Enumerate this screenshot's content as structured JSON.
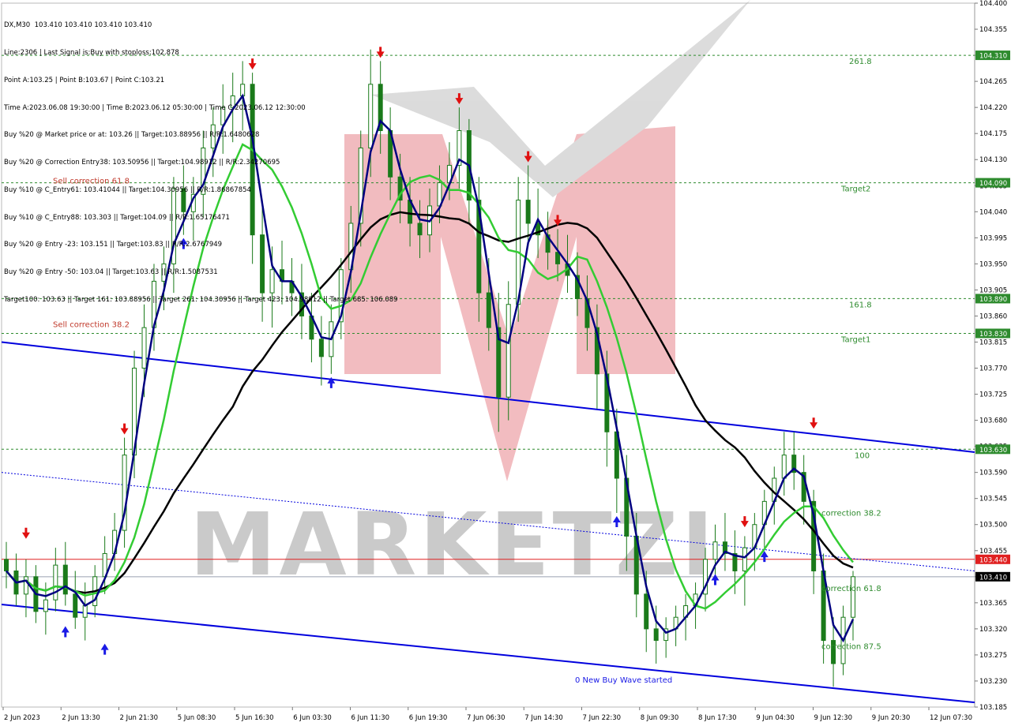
{
  "symbol_header": "DX,M30  103.410 103.410 103.410 103.410",
  "info_lines": [
    "Line:2306 | Last Signal is:Buy with stoploss:102.878",
    "Point A:103.25 | Point B:103.67 | Point C:103.21",
    "Time A:2023.06.08 19:30:00 | Time B:2023.06.12 05:30:00 | Time C:2023.06.12 12:30:00",
    "Buy %20 @ Market price or at: 103.26 || Target:103.88956 || R/R:1.6480628",
    "Buy %20 @ Correction Entry38: 103.50956 || Target:104.98912 || R/R:2.34270695",
    "Buy %10 @ C_Entry61: 103.41044 || Target:104.30956 || R/R:1.86867854",
    "Buy %10 @ C_Entry88: 103.303 || Target:104.09 || R/R:1.65176471",
    "Buy %20 @ Entry -23: 103.151 || Target:103.83 || R/R:2.6767949",
    "Buy %20 @ Entry -50: 103.04 || Target:103.63 || R/R:1.5087531",
    "Target100: 103.63 || Target 161: 103.88956 || Target 261: 104.30956 || Target 423: 104.98912 || Target 685: 106.089"
  ],
  "chart_data": {
    "type": "candlestick",
    "symbol": "DX",
    "timeframe": "M30",
    "ylim": [
      103.185,
      104.4
    ],
    "y_ticks": [
      "104.400",
      "104.355",
      "104.310",
      "104.265",
      "104.220",
      "104.175",
      "104.130",
      "104.085",
      "104.040",
      "103.995",
      "103.950",
      "103.905",
      "103.860",
      "103.815",
      "103.770",
      "103.725",
      "103.680",
      "103.635",
      "103.590",
      "103.545",
      "103.500",
      "103.455",
      "103.410",
      "103.365",
      "103.320",
      "103.275",
      "103.230",
      "103.185"
    ],
    "x_ticks": [
      "2 Jun 2023",
      "2 Jun 13:30",
      "2 Jun 21:30",
      "5 Jun 08:30",
      "5 Jun 16:30",
      "6 Jun 03:30",
      "6 Jun 11:30",
      "6 Jun 19:30",
      "7 Jun 06:30",
      "7 Jun 14:30",
      "7 Jun 22:30",
      "8 Jun 09:30",
      "8 Jun 17:30",
      "9 Jun 04:30",
      "9 Jun 12:30",
      "9 Jun 20:30",
      "12 Jun 07:30"
    ],
    "current_price": 103.41,
    "levels": [
      {
        "label": "261.8",
        "price": 104.31,
        "tag": "104.310",
        "color": "#2e8b2e"
      },
      {
        "label": "Target2",
        "price": 104.09,
        "tag": "104.090",
        "color": "#2e8b2e"
      },
      {
        "label": "161.8",
        "price": 103.89,
        "tag": "103.890",
        "color": "#2e8b2e"
      },
      {
        "label": "Target1",
        "price": 103.83,
        "tag": "103.830",
        "color": "#2e8b2e"
      },
      {
        "label": "100",
        "price": 103.63,
        "tag": "103.630",
        "color": "#2e8b2e"
      },
      {
        "label": "",
        "price": 103.44,
        "tag": "103.440",
        "color": "#e02020"
      }
    ],
    "annotations": [
      {
        "text": "Sell correction 61.8",
        "color": "#c0392b"
      },
      {
        "text": "Sell correction 38.2",
        "color": "#c0392b"
      },
      {
        "text": "correction 38.2",
        "color": "#2e8b2e"
      },
      {
        "text": "correction 61.8",
        "color": "#2e8b2e"
      },
      {
        "text": "correction 87.5",
        "color": "#2e8b2e"
      },
      {
        "text": "0 New Buy Wave started",
        "color": "#1a1ae6"
      }
    ],
    "colors": {
      "candle": "#1a7a1a",
      "ma_slow": "#000000",
      "ma_green": "#33cc33",
      "ma_navy": "#000080",
      "channel": "#0000dd",
      "level": "#2e8b2e",
      "stop": "#e02020"
    },
    "ohlc": [
      [
        103.44,
        103.47,
        103.39,
        103.42
      ],
      [
        103.42,
        103.45,
        103.36,
        103.38
      ],
      [
        103.38,
        103.44,
        103.34,
        103.41
      ],
      [
        103.41,
        103.43,
        103.33,
        103.35
      ],
      [
        103.35,
        103.4,
        103.31,
        103.37
      ],
      [
        103.37,
        103.46,
        103.35,
        103.43
      ],
      [
        103.43,
        103.47,
        103.36,
        103.38
      ],
      [
        103.38,
        103.42,
        103.32,
        103.34
      ],
      [
        103.34,
        103.4,
        103.3,
        103.36
      ],
      [
        103.36,
        103.43,
        103.34,
        103.41
      ],
      [
        103.41,
        103.48,
        103.38,
        103.45
      ],
      [
        103.45,
        103.52,
        103.42,
        103.49
      ],
      [
        103.49,
        103.65,
        103.46,
        103.62
      ],
      [
        103.62,
        103.8,
        103.58,
        103.77
      ],
      [
        103.77,
        103.88,
        103.72,
        103.84
      ],
      [
        103.84,
        103.95,
        103.8,
        103.92
      ],
      [
        103.92,
        103.98,
        103.87,
        103.95
      ],
      [
        103.95,
        104.1,
        103.9,
        104.08
      ],
      [
        104.08,
        104.12,
        104.0,
        104.04
      ],
      [
        104.04,
        104.1,
        103.99,
        104.07
      ],
      [
        104.07,
        104.18,
        104.03,
        104.15
      ],
      [
        104.15,
        104.22,
        104.1,
        104.19
      ],
      [
        104.19,
        104.26,
        104.14,
        104.22
      ],
      [
        104.22,
        104.28,
        104.16,
        104.24
      ],
      [
        104.24,
        104.3,
        104.18,
        104.26
      ],
      [
        104.26,
        104.28,
        103.95,
        104.0
      ],
      [
        104.0,
        104.06,
        103.85,
        103.9
      ],
      [
        103.9,
        103.98,
        103.84,
        103.94
      ],
      [
        103.94,
        103.99,
        103.88,
        103.92
      ],
      [
        103.92,
        103.96,
        103.86,
        103.9
      ],
      [
        103.9,
        103.95,
        103.82,
        103.86
      ],
      [
        103.86,
        103.9,
        103.78,
        103.82
      ],
      [
        103.82,
        103.86,
        103.74,
        103.79
      ],
      [
        103.79,
        103.88,
        103.76,
        103.85
      ],
      [
        103.85,
        103.96,
        103.82,
        103.94
      ],
      [
        103.94,
        104.05,
        103.9,
        104.02
      ],
      [
        104.02,
        104.18,
        103.98,
        104.15
      ],
      [
        104.15,
        104.32,
        104.1,
        104.26
      ],
      [
        104.26,
        104.3,
        104.14,
        104.18
      ],
      [
        104.18,
        104.22,
        104.06,
        104.1
      ],
      [
        104.1,
        104.14,
        104.02,
        104.06
      ],
      [
        104.06,
        104.1,
        103.98,
        104.02
      ],
      [
        104.02,
        104.06,
        103.96,
        104.0
      ],
      [
        104.0,
        104.08,
        103.97,
        104.05
      ],
      [
        104.05,
        104.12,
        104.02,
        104.09
      ],
      [
        104.09,
        104.16,
        104.06,
        104.12
      ],
      [
        104.12,
        104.22,
        104.08,
        104.18
      ],
      [
        104.18,
        104.2,
        104.02,
        104.06
      ],
      [
        104.06,
        104.1,
        103.85,
        103.9
      ],
      [
        103.9,
        103.96,
        103.8,
        103.84
      ],
      [
        103.84,
        103.9,
        103.66,
        103.72
      ],
      [
        103.72,
        103.92,
        103.68,
        103.88
      ],
      [
        103.88,
        104.1,
        103.85,
        104.06
      ],
      [
        104.06,
        104.12,
        103.98,
        104.02
      ],
      [
        104.02,
        104.08,
        103.96,
        104.0
      ],
      [
        104.0,
        104.04,
        103.94,
        103.97
      ],
      [
        103.97,
        104.01,
        103.92,
        103.95
      ],
      [
        103.95,
        104.0,
        103.9,
        103.93
      ],
      [
        103.93,
        103.97,
        103.86,
        103.89
      ],
      [
        103.89,
        103.93,
        103.8,
        103.84
      ],
      [
        103.84,
        103.88,
        103.7,
        103.76
      ],
      [
        103.76,
        103.8,
        103.6,
        103.66
      ],
      [
        103.66,
        103.7,
        103.52,
        103.58
      ],
      [
        103.58,
        103.62,
        103.42,
        103.48
      ],
      [
        103.48,
        103.52,
        103.34,
        103.38
      ],
      [
        103.38,
        103.42,
        103.28,
        103.32
      ],
      [
        103.32,
        103.36,
        103.26,
        103.3
      ],
      [
        103.3,
        103.34,
        103.27,
        103.32
      ],
      [
        103.32,
        103.36,
        103.29,
        103.34
      ],
      [
        103.34,
        103.38,
        103.3,
        103.36
      ],
      [
        103.36,
        103.4,
        103.32,
        103.38
      ],
      [
        103.38,
        103.46,
        103.35,
        103.44
      ],
      [
        103.44,
        103.5,
        103.4,
        103.47
      ],
      [
        103.47,
        103.52,
        103.42,
        103.45
      ],
      [
        103.45,
        103.49,
        103.38,
        103.42
      ],
      [
        103.42,
        103.48,
        103.36,
        103.46
      ],
      [
        103.46,
        103.52,
        103.42,
        103.5
      ],
      [
        103.5,
        103.56,
        103.46,
        103.54
      ],
      [
        103.54,
        103.6,
        103.5,
        103.58
      ],
      [
        103.58,
        103.66,
        103.55,
        103.62
      ],
      [
        103.62,
        103.66,
        103.56,
        103.59
      ],
      [
        103.59,
        103.62,
        103.5,
        103.54
      ],
      [
        103.54,
        103.56,
        103.38,
        103.42
      ],
      [
        103.42,
        103.45,
        103.26,
        103.3
      ],
      [
        103.3,
        103.34,
        103.22,
        103.26
      ],
      [
        103.26,
        103.36,
        103.24,
        103.34
      ],
      [
        103.34,
        103.42,
        103.3,
        103.41
      ]
    ]
  }
}
